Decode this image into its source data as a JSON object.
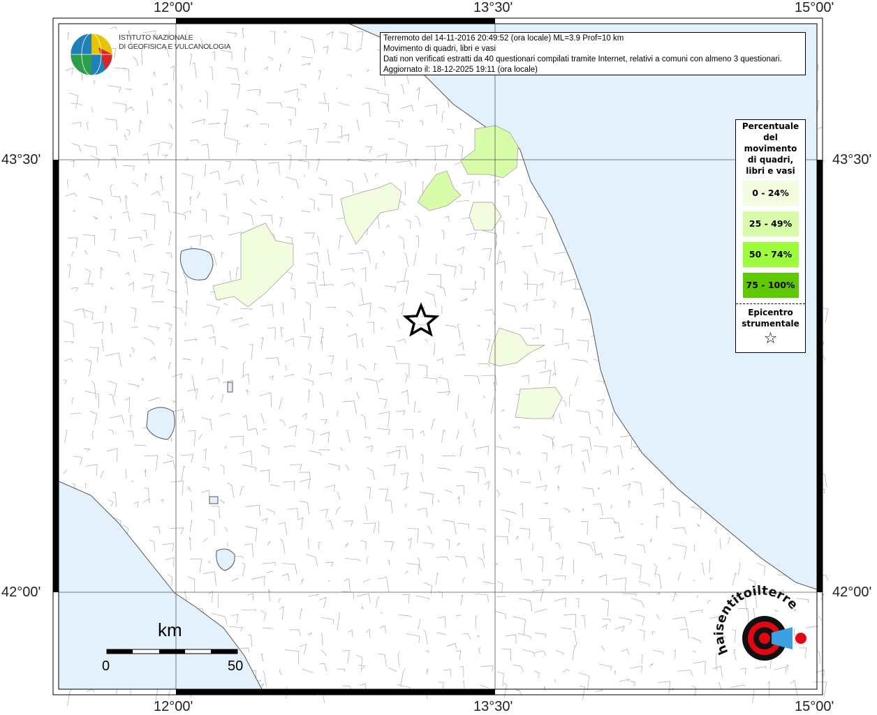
{
  "axes": {
    "lon_labels": [
      "12°00'",
      "13°30'",
      "15°00'"
    ],
    "lat_labels": [
      "43°30'",
      "42°00'"
    ]
  },
  "info": {
    "line1": "Terremoto del 14-11-2016 20:49:52 (ora locale) ML=3.9 Prof=10 km",
    "line2": "Movimento di quadri, libri e vasi",
    "line3": "Dati non verificati estratti da 40 questionari compilati tramite Internet, relativi a comuni con almeno 3 questionari.",
    "line4": "Aggiornato il: 18-12-2025 19:11 (ora locale)"
  },
  "logo": {
    "line1": "ISTITUTO NAZIONALE",
    "line2": "DI GEOFISICA E VULCANOLOGIA"
  },
  "legend": {
    "title": "Percentuale del movimento di quadri, libri e vasi",
    "classes": [
      {
        "label": "0 - 24%",
        "color": "#f2fde0"
      },
      {
        "label": "25 - 49%",
        "color": "#d8fcaa"
      },
      {
        "label": "50 - 74%",
        "color": "#9cfb3a"
      },
      {
        "label": "75 - 100%",
        "color": "#5ec800"
      }
    ],
    "epicenter_label": "Epicentro strumentale",
    "epicenter_icon": "star-outline-icon"
  },
  "scale": {
    "unit": "km",
    "start": "0",
    "end": "50"
  },
  "watermark": "www.haisentitoilterremoto.it",
  "colors": {
    "sea": "#e2f1fc",
    "land": "#ffffff",
    "borders": "#999999"
  }
}
